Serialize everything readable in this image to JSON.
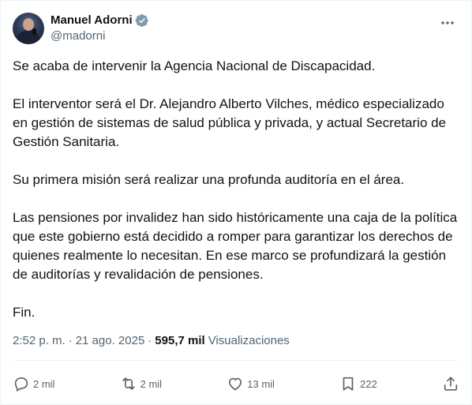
{
  "author": {
    "name": "Manuel Adorni",
    "handle": "@madorni"
  },
  "icons": {
    "verified": "verified-badge-icon",
    "more": "more-horizontal-icon",
    "reply": "reply-icon",
    "repost": "repost-icon",
    "like": "heart-icon",
    "bookmark": "bookmark-icon",
    "share": "share-icon"
  },
  "colors": {
    "verified": "#829aab",
    "secondary_text": "#536471",
    "primary_text": "#0f1419"
  },
  "body": {
    "p1": "Se acaba de intervenir la Agencia Nacional de Discapacidad.",
    "p2": "El interventor será el Dr. Alejandro Alberto Vilches, médico especializado en gestión de sistemas de salud pública y privada, y actual Secretario de Gestión Sanitaria.",
    "p3": "Su primera misión será realizar una profunda auditoría en el área.",
    "p4": "Las pensiones por invalidez han sido históricamente una caja de la política que este gobierno está decidido a romper para garantizar los derechos de quienes realmente lo necesitan. En ese marco se profundizará la gestión de auditorías y revalidación de pensiones.",
    "p5": "Fin."
  },
  "meta": {
    "time": "2:52 p. m.",
    "separator": "·",
    "date": "21 ago. 2025",
    "separator2": "·",
    "views_count": "595,7 mil",
    "views_label": "Visualizaciones"
  },
  "actions": {
    "replies": "2 mil",
    "reposts": "2 mil",
    "likes": "13 mil",
    "bookmarks": "222"
  }
}
